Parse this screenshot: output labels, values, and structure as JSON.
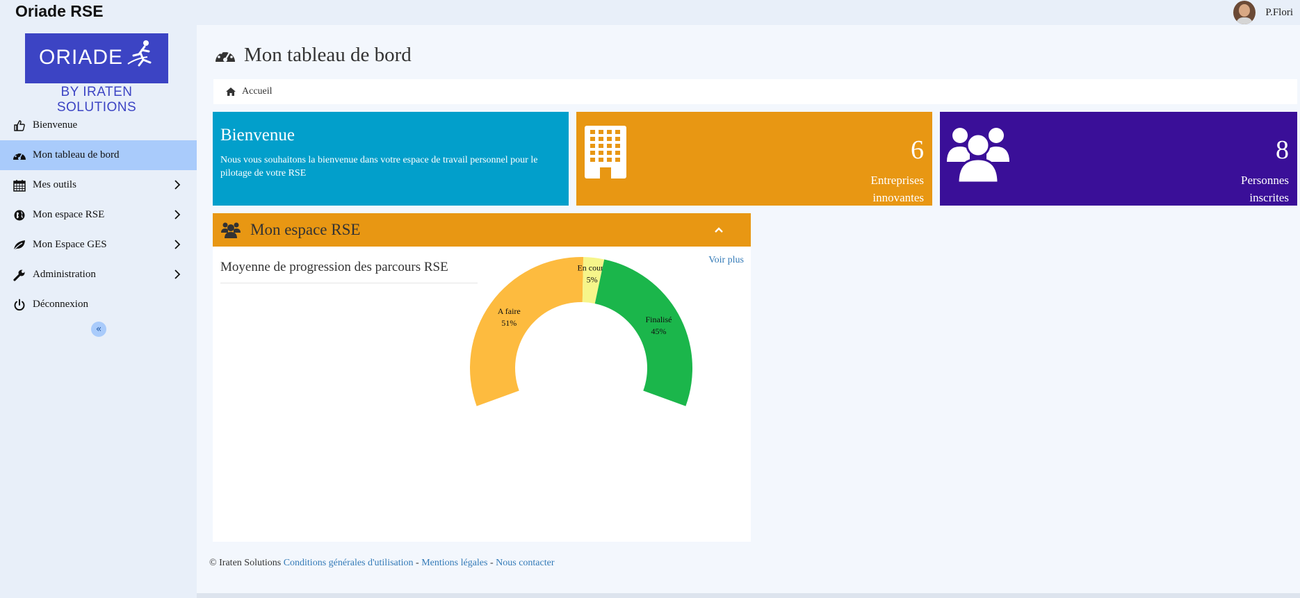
{
  "app": {
    "title": "Oriade RSE"
  },
  "user": {
    "name": "P.Flori"
  },
  "logo": {
    "word": "ORIADE",
    "subtitle": "BY IRATEN SOLUTIONS"
  },
  "sidebar": {
    "items": [
      {
        "label": "Bienvenue",
        "icon": "thumbs-up-icon",
        "active": false,
        "submenu": false
      },
      {
        "label": "Mon tableau de bord",
        "icon": "dashboard-icon",
        "active": true,
        "submenu": false
      },
      {
        "label": "Mes outils",
        "icon": "calendar-icon",
        "active": false,
        "submenu": true
      },
      {
        "label": "Mon espace RSE",
        "icon": "globe-icon",
        "active": false,
        "submenu": true
      },
      {
        "label": "Mon Espace GES",
        "icon": "leaf-icon",
        "active": false,
        "submenu": true
      },
      {
        "label": "Administration",
        "icon": "wrench-icon",
        "active": false,
        "submenu": true
      },
      {
        "label": "Déconnexion",
        "icon": "power-icon",
        "active": false,
        "submenu": false
      }
    ],
    "collapse_icon": "«"
  },
  "page": {
    "title": "Mon tableau de bord"
  },
  "breadcrumb": {
    "home": "Accueil"
  },
  "tiles": {
    "welcome": {
      "title": "Bienvenue",
      "text": "Nous vous souhaitons la bienvenue dans votre espace de travail personnel pour le pilotage de votre RSE"
    },
    "companies": {
      "count": "6",
      "line1": "Entreprises",
      "line2": "innovantes",
      "icon": "building-icon"
    },
    "people": {
      "count": "8",
      "line1": "Personnes",
      "line2": "inscrites",
      "icon": "users-icon"
    }
  },
  "panel": {
    "title": "Mon espace RSE",
    "chart_title": "Moyenne de progression des parcours RSE",
    "more_link": "Voir plus"
  },
  "chart_data": {
    "type": "pie",
    "variant": "semi-donut",
    "title": "Moyenne de progression des parcours RSE",
    "categories": [
      "A faire",
      "En cours",
      "Finalisé"
    ],
    "values": [
      51,
      5,
      45
    ],
    "labels": [
      "51%",
      "5%",
      "45%"
    ],
    "colors": [
      "#fdbb3f",
      "#f6f58a",
      "#1bb64b"
    ]
  },
  "footer": {
    "copyright": "© Iraten Solutions",
    "links": [
      "Conditions générales d'utilisation",
      "Mentions légales",
      "Nous contacter"
    ],
    "separator": " - "
  },
  "colors": {
    "sidebar_bg": "#e8eff9",
    "active_item": "#a9cbfb",
    "welcome_tile": "#029fcb",
    "orange_tile": "#e89713",
    "purple_tile": "#3a0f98",
    "link": "#337ab7"
  }
}
